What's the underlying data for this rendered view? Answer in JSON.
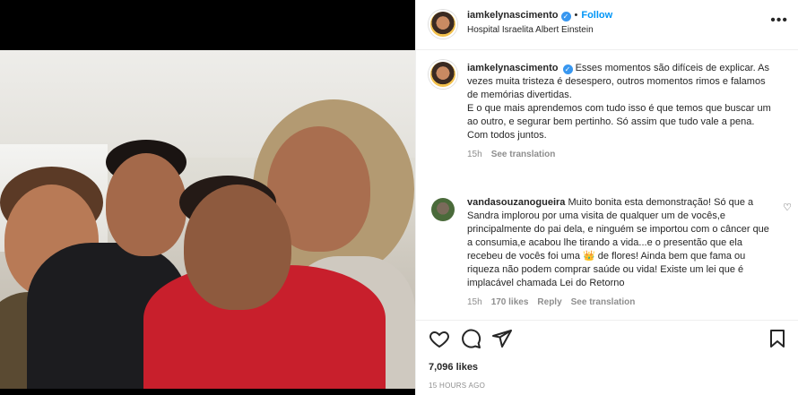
{
  "post": {
    "username": "iamkelynascimento",
    "follow_label": "Follow",
    "location": "Hospital Israelita Albert Einstein",
    "more": "•••"
  },
  "caption": {
    "username": "iamkelynascimento",
    "text_1": "Esses momentos são difíceis de explicar. As vezes muita tristeza é desespero, outros momentos rimos e falamos de memórias divertidas.",
    "text_2": "E o que mais aprendemos com tudo isso é que temos que buscar um ao outro, e segurar bem pertinho. Só assim que tudo vale a pena.",
    "text_3": "Com todos juntos.",
    "age": "15h",
    "see_translation": "See translation"
  },
  "comment": {
    "username": "vandasouzanogueira",
    "text": "Muito bonita esta demonstração! Só que a Sandra implorou por uma visita de qualquer um de vocês,e principalmente do pai dela, e ninguém se importou com o câncer que a consumia,e acabou lhe tirando a vida...e o presentão que ela recebeu de vocês foi uma 👑 de flores! Ainda bem que fama ou riqueza não podem comprar saúde ou vida! Existe um lei que é implacável chamada Lei do Retorno",
    "age": "15h",
    "likes": "170 likes",
    "reply": "Reply",
    "see_translation": "See translation"
  },
  "footer": {
    "likes": "7,096 likes",
    "timestamp": "15 HOURS AGO"
  },
  "icons": {
    "verified": "verified-badge-icon",
    "like": "heart-icon",
    "comment": "comment-bubble-icon",
    "share": "paper-plane-icon",
    "save": "bookmark-icon"
  },
  "colors": {
    "accent": "#0095f6",
    "verified": "#3897f0",
    "muted": "#8e8e8e",
    "text": "#262626"
  }
}
